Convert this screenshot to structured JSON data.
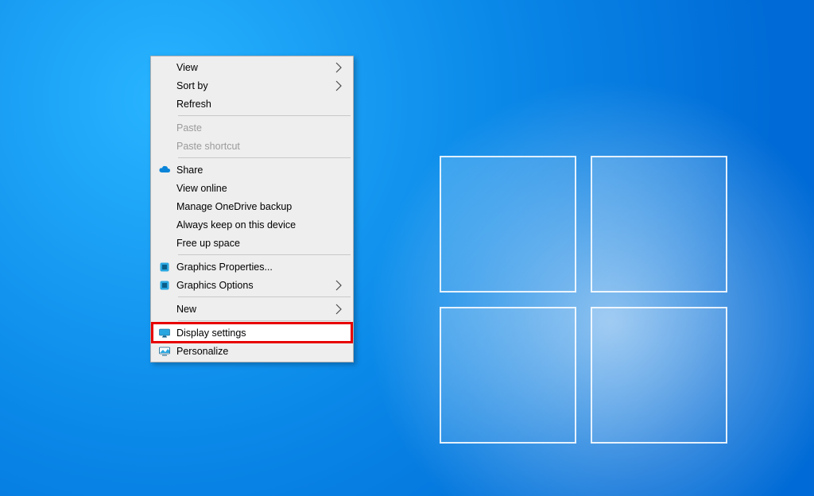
{
  "context_menu": {
    "view": {
      "label": "View",
      "submenu": true
    },
    "sort_by": {
      "label": "Sort by",
      "submenu": true
    },
    "refresh": {
      "label": "Refresh"
    },
    "paste": {
      "label": "Paste",
      "disabled": true
    },
    "paste_shortcut": {
      "label": "Paste shortcut",
      "disabled": true
    },
    "share": {
      "label": "Share"
    },
    "view_online": {
      "label": "View online"
    },
    "manage_onedrive": {
      "label": "Manage OneDrive backup"
    },
    "always_keep": {
      "label": "Always keep on this device"
    },
    "free_up_space": {
      "label": "Free up space"
    },
    "graphics_props": {
      "label": "Graphics Properties..."
    },
    "graphics_opts": {
      "label": "Graphics Options",
      "submenu": true
    },
    "new": {
      "label": "New",
      "submenu": true
    },
    "display_settings": {
      "label": "Display settings",
      "highlighted": true
    },
    "personalize": {
      "label": "Personalize"
    }
  }
}
